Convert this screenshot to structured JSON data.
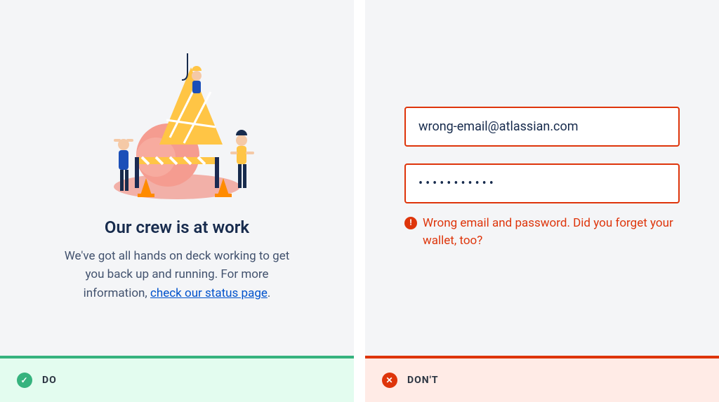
{
  "do_card": {
    "heading": "Our crew is at work",
    "body_before_link": "We've got all hands on deck working to get you back up and running. For more information, ",
    "link_text": "check our status page",
    "body_after_link": ".",
    "footer_label": "DO"
  },
  "dont_card": {
    "email_value": "wrong-email@atlassian.com",
    "password_masked": "•••••••••••",
    "error_message": "Wrong email and password. Did you forget your wallet, too?",
    "footer_label": "DON'T"
  },
  "icons": {
    "check": "✓",
    "cross": "✕",
    "warning": "!"
  }
}
